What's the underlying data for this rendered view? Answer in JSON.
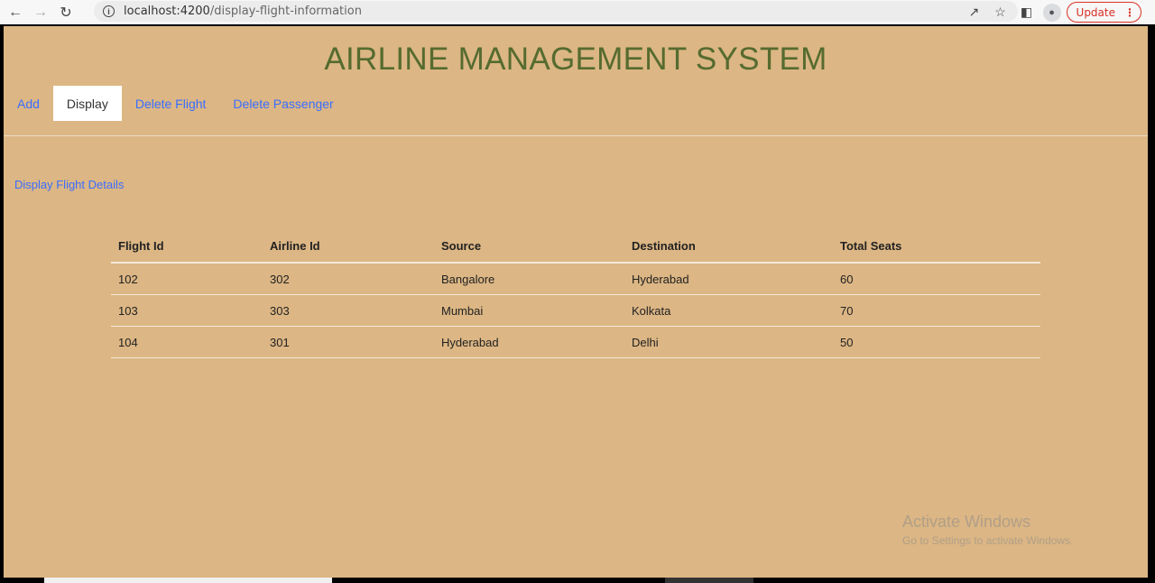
{
  "browser": {
    "url_host": "localhost:4200",
    "url_path": "/display-flight-information",
    "update_label": "Update"
  },
  "app": {
    "title": "AIRLINE MANAGEMENT SYSTEM",
    "tabs": [
      {
        "label": "Add",
        "active": false
      },
      {
        "label": "Display",
        "active": true
      },
      {
        "label": "Delete Flight",
        "active": false
      },
      {
        "label": "Delete Passenger",
        "active": false
      }
    ],
    "section_link": "Display Flight Details"
  },
  "table": {
    "headers": [
      "Flight Id",
      "Airline Id",
      "Source",
      "Destination",
      "Total Seats"
    ],
    "rows": [
      [
        "102",
        "302",
        "Bangalore",
        "Hyderabad",
        "60"
      ],
      [
        "103",
        "303",
        "Mumbai",
        "Kolkata",
        "70"
      ],
      [
        "104",
        "301",
        "Hyderabad",
        "Delhi",
        "50"
      ]
    ]
  },
  "watermark": {
    "line1": "Activate Windows",
    "line2": "Go to Settings to activate Windows."
  },
  "colors": {
    "page_bg": "#dcb684",
    "title": "#556b2f",
    "link": "#3a6eff"
  }
}
